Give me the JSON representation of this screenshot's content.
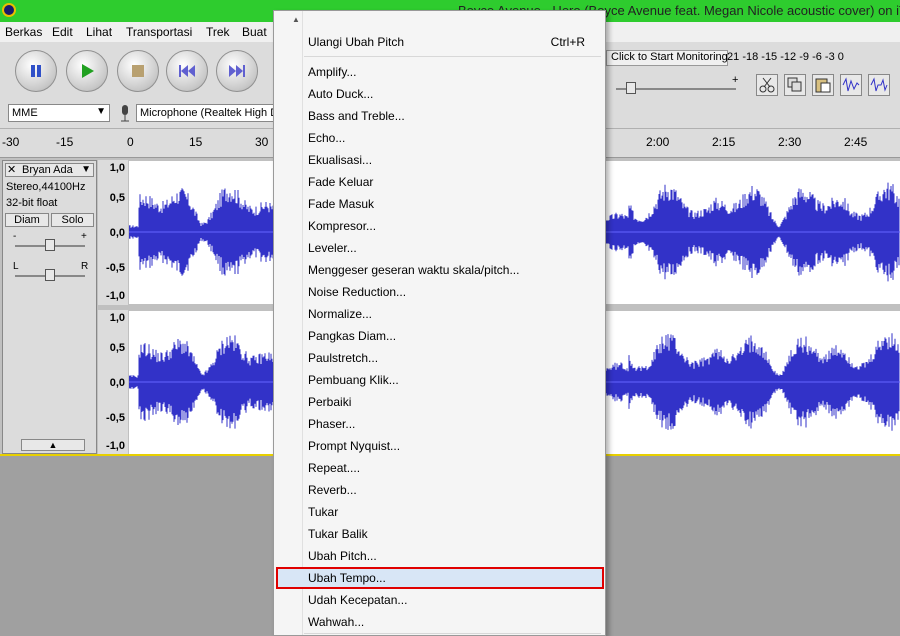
{
  "window": {
    "title": "Boyce Avenue - Hero (Boyce Avenue feat. Megan Nicole acoustic cover) on iTunes"
  },
  "menubar": [
    "Berkas",
    "Edit",
    "Lihat",
    "Transportasi",
    "Trek",
    "Buat"
  ],
  "device": {
    "host": "MME",
    "input": "Microphone (Realtek High D"
  },
  "meter": {
    "click_label": "Click to Start Monitoring",
    "scale": [
      "21",
      "-18",
      "-15",
      "-12",
      "-9",
      "-6",
      "-3",
      "0"
    ]
  },
  "ruler": [
    "-30",
    "-15",
    "0",
    "15",
    "30",
    "2:00",
    "2:15",
    "2:30",
    "2:45"
  ],
  "track": {
    "name": "Bryan Ada",
    "format": "Stereo,44100Hz",
    "bitdepth": "32-bit float",
    "mute": "Diam",
    "solo": "Solo",
    "gain_minus": "-",
    "gain_plus": "+",
    "pan_left": "L",
    "pan_right": "R",
    "scale": [
      "1,0",
      "0,5",
      "0,0",
      "-0,5",
      "-1,0"
    ]
  },
  "menu": {
    "first": {
      "label": "Ulangi Ubah Pitch",
      "shortcut": "Ctrl+R"
    },
    "items": [
      "Amplify...",
      "Auto Duck...",
      "Bass and Treble...",
      "Echo...",
      "Ekualisasi...",
      "Fade Keluar",
      "Fade Masuk",
      "Kompresor...",
      "Leveler...",
      "Menggeser geseran waktu skala/pitch...",
      "Noise Reduction...",
      "Normalize...",
      "Pangkas Diam...",
      "Paulstretch...",
      "Pembuang Klik...",
      "Perbaiki",
      "Phaser...",
      "Prompt Nyquist...",
      "Repeat....",
      "Reverb...",
      "Tukar",
      "Tukar Balik",
      "Ubah Pitch...",
      "Ubah Tempo...",
      "Udah Kecepatan...",
      "Wahwah..."
    ],
    "highlighted": "Ubah Tempo..."
  },
  "colors": {
    "title_bar": "#2ecc2e",
    "waveform": "#3232c8",
    "highlight_border": "#e00000"
  }
}
